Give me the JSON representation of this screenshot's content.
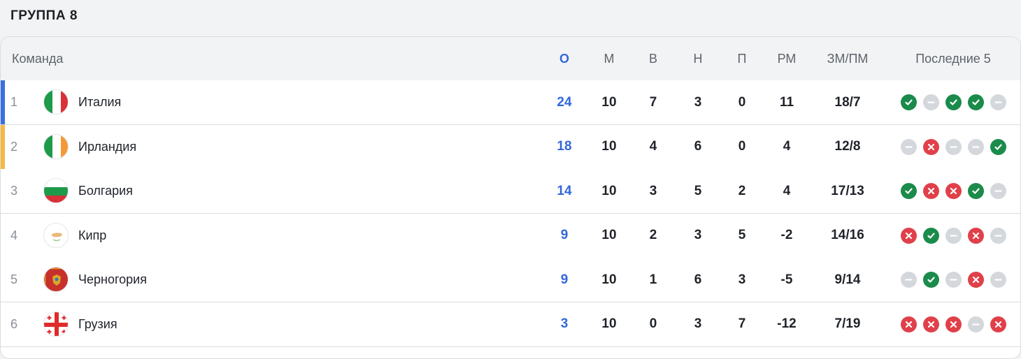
{
  "group_title": "ГРУППА 8",
  "columns": {
    "team": "Команда",
    "points": "О",
    "played": "М",
    "wins": "В",
    "draws": "Н",
    "losses": "П",
    "goal_diff": "РМ",
    "goals": "ЗМ/ПМ",
    "last5": "Последние 5"
  },
  "rows": [
    {
      "rank": "1",
      "team": "Италия",
      "points": "24",
      "played": "10",
      "wins": "7",
      "draws": "3",
      "losses": "0",
      "goal_diff": "11",
      "goals": "18/7",
      "marker": "#3b6fe0",
      "flag": "italy-flag-icon",
      "form": [
        "W",
        "D",
        "W",
        "W",
        "D"
      ]
    },
    {
      "rank": "2",
      "team": "Ирландия",
      "points": "18",
      "played": "10",
      "wins": "4",
      "draws": "6",
      "losses": "0",
      "goal_diff": "4",
      "goals": "12/8",
      "marker": "#f4b942",
      "flag": "ireland-flag-icon",
      "form": [
        "D",
        "L",
        "D",
        "D",
        "W"
      ]
    },
    {
      "rank": "3",
      "team": "Болгария",
      "points": "14",
      "played": "10",
      "wins": "3",
      "draws": "5",
      "losses": "2",
      "goal_diff": "4",
      "goals": "17/13",
      "marker": null,
      "flag": "bulgaria-flag-icon",
      "form": [
        "W",
        "L",
        "L",
        "W",
        "D"
      ]
    },
    {
      "rank": "4",
      "team": "Кипр",
      "points": "9",
      "played": "10",
      "wins": "2",
      "draws": "3",
      "losses": "5",
      "goal_diff": "-2",
      "goals": "14/16",
      "marker": null,
      "flag": "cyprus-flag-icon",
      "form": [
        "L",
        "W",
        "D",
        "L",
        "D"
      ]
    },
    {
      "rank": "5",
      "team": "Черногория",
      "points": "9",
      "played": "10",
      "wins": "1",
      "draws": "6",
      "losses": "3",
      "goal_diff": "-5",
      "goals": "9/14",
      "marker": null,
      "flag": "montenegro-flag-icon",
      "form": [
        "D",
        "W",
        "D",
        "L",
        "D"
      ]
    },
    {
      "rank": "6",
      "team": "Грузия",
      "points": "3",
      "played": "10",
      "wins": "0",
      "draws": "3",
      "losses": "7",
      "goal_diff": "-12",
      "goals": "7/19",
      "marker": null,
      "flag": "georgia-flag-icon",
      "form": [
        "L",
        "L",
        "L",
        "D",
        "L"
      ]
    }
  ],
  "form_legend": {
    "W": "win-icon",
    "D": "draw-icon",
    "L": "loss-icon"
  },
  "colors": {
    "points": "#3267dc",
    "win": "#1a8b4a",
    "draw": "#d4d7dc",
    "loss": "#e0404a",
    "first_marker": "#3b6fe0",
    "second_marker": "#f4b942"
  }
}
